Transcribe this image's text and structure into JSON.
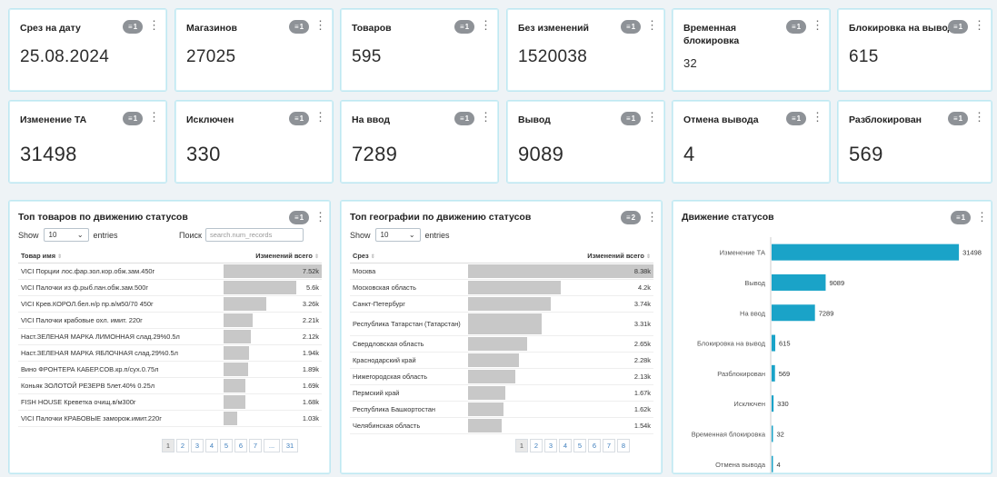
{
  "kpis_row1": [
    {
      "title": "Срез на дату",
      "value": "25.08.2024",
      "badge": "1"
    },
    {
      "title": "Магазинов",
      "value": "27025",
      "badge": "1"
    },
    {
      "title": "Товаров",
      "value": "595",
      "badge": "1"
    },
    {
      "title": "Без изменений",
      "value": "1520038",
      "badge": "1"
    },
    {
      "title": "Временная блокировка",
      "value": "32",
      "badge": "1"
    },
    {
      "title": "Блокировка на вывод",
      "value": "615",
      "badge": "1"
    }
  ],
  "kpis_row2": [
    {
      "title": "Изменение ТА",
      "value": "31498",
      "badge": "1"
    },
    {
      "title": "Исключен",
      "value": "330",
      "badge": "1"
    },
    {
      "title": "На ввод",
      "value": "7289",
      "badge": "1"
    },
    {
      "title": "Вывод",
      "value": "9089",
      "badge": "1"
    },
    {
      "title": "Отмена вывода",
      "value": "4",
      "badge": "1"
    },
    {
      "title": "Разблокирован",
      "value": "569",
      "badge": "1"
    }
  ],
  "products": {
    "title": "Топ товаров по движению статусов",
    "badge": "1",
    "show_label": "Show",
    "entries_value": "10",
    "entries_label": "entries",
    "search_label": "Поиск",
    "search_placeholder": "search.num_records",
    "col_name": "Товар имя",
    "col_value": "Изменений всего",
    "rows": [
      {
        "name": "VICI Порции лос.фар.зол.кор.обж.зам.450г",
        "value": "7.52k",
        "num": 7520
      },
      {
        "name": "VICI Палочки из ф.рыб.пан.обж.зам.500г",
        "value": "5.6k",
        "num": 5600
      },
      {
        "name": "VICI Крев.КОРОЛ.бел.н/р пр.в/м50/70 450г",
        "value": "3.26k",
        "num": 3260
      },
      {
        "name": "VICI Палочки крабовые охл. имит. 220г",
        "value": "2.21k",
        "num": 2210
      },
      {
        "name": "Наст.ЗЕЛЕНАЯ МАРКА ЛИМОННАЯ слад.29%0.5л",
        "value": "2.12k",
        "num": 2120
      },
      {
        "name": "Наст.ЗЕЛЕНАЯ МАРКА ЯБЛОЧНАЯ слад.29%0.5л",
        "value": "1.94k",
        "num": 1940
      },
      {
        "name": "Вино ФРОНТЕРА КАБЕР.СОВ.кр.п/сух.0.75л",
        "value": "1.89k",
        "num": 1890
      },
      {
        "name": "Коньяк ЗОЛОТОЙ РЕЗЕРВ 5лет.40% 0.25л",
        "value": "1.69k",
        "num": 1690
      },
      {
        "name": "FISH HOUSE Креветка очищ.в/м300г",
        "value": "1.68k",
        "num": 1680
      },
      {
        "name": "VICI Палочки КРАБОВЫЕ заморож.имит.220г",
        "value": "1.03k",
        "num": 1030
      }
    ],
    "pages": [
      "1",
      "2",
      "3",
      "4",
      "5",
      "6",
      "7",
      "...",
      "31"
    ]
  },
  "geo": {
    "title": "Топ географии по движению статусов",
    "badge": "2",
    "show_label": "Show",
    "entries_value": "10",
    "entries_label": "entries",
    "col_name": "Срез",
    "col_value": "Изменений всего",
    "rows": [
      {
        "name": "Москва",
        "value": "8.38k",
        "num": 8380
      },
      {
        "name": "Московская область",
        "value": "4.2k",
        "num": 4200
      },
      {
        "name": "Санкт-Петербург",
        "value": "3.74k",
        "num": 3740
      },
      {
        "name": "Республика Татарстан (Татарстан)",
        "value": "3.31k",
        "num": 3310
      },
      {
        "name": "Свердловская область",
        "value": "2.65k",
        "num": 2650
      },
      {
        "name": "Краснодарский край",
        "value": "2.28k",
        "num": 2280
      },
      {
        "name": "Нижегородская область",
        "value": "2.13k",
        "num": 2130
      },
      {
        "name": "Пермский край",
        "value": "1.67k",
        "num": 1670
      },
      {
        "name": "Республика Башкортостан",
        "value": "1.62k",
        "num": 1620
      },
      {
        "name": "Челябинская область",
        "value": "1.54k",
        "num": 1540
      }
    ],
    "pages": [
      "1",
      "2",
      "3",
      "4",
      "5",
      "6",
      "7",
      "8"
    ]
  },
  "chart_panel": {
    "title": "Движение статусов",
    "badge": "1"
  },
  "colors": {
    "bar": "#1aa3c8",
    "badge": "#8e9297",
    "border": "#bfe8f2"
  },
  "chart_data": {
    "type": "bar",
    "orientation": "horizontal",
    "categories": [
      "Изменение ТА",
      "Вывод",
      "На ввод",
      "Блокировка на вывод",
      "Разблокирован",
      "Исключен",
      "Временная блокировка",
      "Отмена вывода"
    ],
    "values": [
      31498,
      9089,
      7289,
      615,
      569,
      330,
      32,
      4
    ],
    "xlim": [
      0,
      35000
    ],
    "xticks": [
      0,
      5000,
      10000,
      15000,
      20000,
      25000,
      30000,
      35000
    ],
    "color": "#1aa3c8"
  }
}
